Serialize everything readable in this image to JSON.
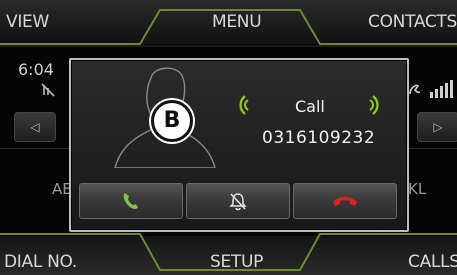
{
  "top_nav": {
    "left_label": "VIEW",
    "center_label": "MENU",
    "right_label": "CONTACTS"
  },
  "bottom_nav": {
    "left_label": "DIAL NO.",
    "center_label": "SETUP",
    "right_label": "CALLS"
  },
  "status": {
    "time": "6:04",
    "no_signal_text": "⚡̸"
  },
  "background": {
    "left_fragment": "AB",
    "right_fragment": "KL",
    "prev_arrow": "◁",
    "next_arrow": "▷"
  },
  "incoming_call": {
    "badge_letter": "B",
    "title": "Call",
    "number": "0316109232",
    "accept_icon": "phone-accept-icon",
    "mute_icon": "bell-mute-icon",
    "decline_icon": "phone-decline-icon"
  },
  "colors": {
    "accept": "#7ec544",
    "decline": "#e02020",
    "wave": "#8fd400",
    "accent_frame": "#9abf28"
  }
}
